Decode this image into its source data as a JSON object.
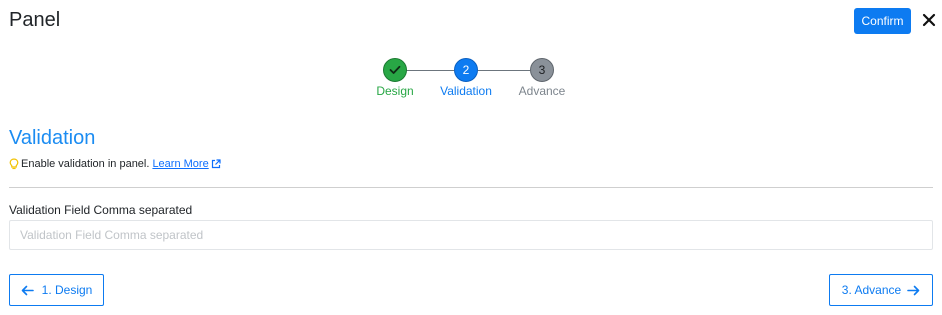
{
  "header": {
    "title": "Panel",
    "confirm_label": "Confirm",
    "close_icon": "close-icon"
  },
  "stepper": {
    "steps": [
      {
        "label": "Design",
        "number": "",
        "state": "done",
        "icon": "check-icon"
      },
      {
        "label": "Validation",
        "number": "2",
        "state": "active"
      },
      {
        "label": "Advance",
        "number": "3",
        "state": "pending"
      }
    ]
  },
  "section": {
    "title": "Validation",
    "hint_text": "Enable validation in panel.",
    "learn_more_label": "Learn More",
    "hint_icon": "lightbulb-icon",
    "link_icon": "external-link-icon"
  },
  "field": {
    "label": "Validation Field Comma separated",
    "placeholder": "Validation Field Comma separated",
    "value": ""
  },
  "footer": {
    "prev_label": "1. Design",
    "next_label": "3. Advance"
  },
  "colors": {
    "primary": "#0d7bf1",
    "success": "#28a745",
    "pending": "#8a9199",
    "section_title": "#1b8cf2"
  }
}
